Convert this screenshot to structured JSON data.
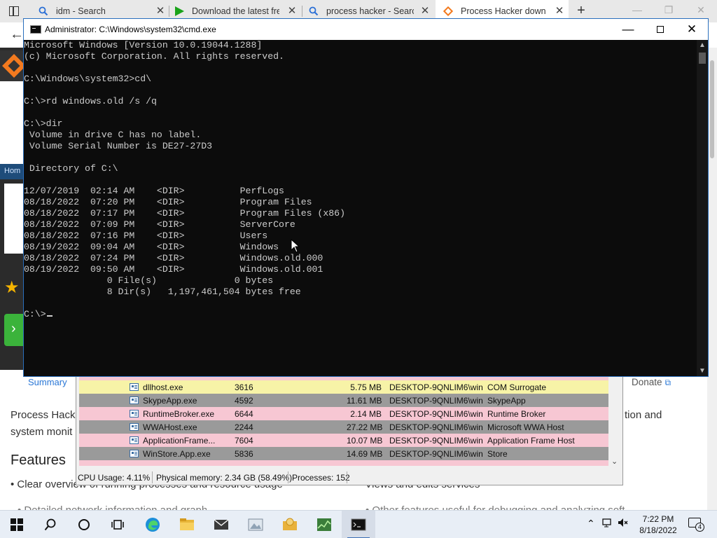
{
  "browser": {
    "tabs": [
      {
        "title": "idm - Search",
        "icon": "search-icon"
      },
      {
        "title": "Download the latest fre",
        "icon": "play-icon"
      },
      {
        "title": "process hacker - Search",
        "icon": "search-icon"
      },
      {
        "title": "Process Hacker downlo",
        "icon": "process-hacker-logo"
      }
    ],
    "side_label": "Hom",
    "summary_link": "Summary",
    "donate_link": "Donate",
    "para1_left": "Process Hack",
    "para1_right": "tion and",
    "para2": "system monit",
    "features_heading": "Features",
    "bullet_left": "• Clear overview of running processes and resource usage",
    "bullet_right": "• Views and edits services",
    "cut_left": "• Detailed network information and graphs",
    "cut_right": "• Other features useful for debugging and analyzing software"
  },
  "process_hacker": {
    "rows": [
      {
        "name": "dllhost.exe",
        "pid": "3616",
        "mem": "5.75 MB",
        "user": "DESKTOP-9QNLIM6\\win",
        "desc": "COM Surrogate",
        "bg": "#f7f3a7"
      },
      {
        "name": "SkypeApp.exe",
        "pid": "4592",
        "mem": "11.61 MB",
        "user": "DESKTOP-9QNLIM6\\win",
        "desc": "SkypeApp",
        "bg": "#9a9a9a"
      },
      {
        "name": "RuntimeBroker.exe",
        "pid": "6644",
        "mem": "2.14 MB",
        "user": "DESKTOP-9QNLIM6\\win",
        "desc": "Runtime Broker",
        "bg": "#f7c7d3"
      },
      {
        "name": "WWAHost.exe",
        "pid": "2244",
        "mem": "27.22 MB",
        "user": "DESKTOP-9QNLIM6\\win",
        "desc": "Microsoft WWA Host",
        "bg": "#9a9a9a"
      },
      {
        "name": "ApplicationFrame...",
        "pid": "7604",
        "mem": "10.07 MB",
        "user": "DESKTOP-9QNLIM6\\win",
        "desc": "Application Frame Host",
        "bg": "#f7c7d3"
      },
      {
        "name": "WinStore.App.exe",
        "pid": "5836",
        "mem": "14.69 MB",
        "user": "DESKTOP-9QNLIM6\\win",
        "desc": "Store",
        "bg": "#9a9a9a"
      }
    ],
    "status": {
      "cpu": "CPU Usage: 4.11%",
      "memory": "Physical memory: 2.34 GB (58.49%)",
      "processes": "Processes: 152"
    }
  },
  "cmd": {
    "title": "Administrator: C:\\Windows\\system32\\cmd.exe",
    "lines": [
      "Microsoft Windows [Version 10.0.19044.1288]",
      "(c) Microsoft Corporation. All rights reserved.",
      "",
      "C:\\Windows\\system32>cd\\",
      "",
      "C:\\>rd windows.old /s /q",
      "",
      "C:\\>dir",
      " Volume in drive C has no label.",
      " Volume Serial Number is DE27-27D3",
      "",
      " Directory of C:\\",
      "",
      "12/07/2019  02:14 AM    <DIR>          PerfLogs",
      "08/18/2022  07:20 PM    <DIR>          Program Files",
      "08/18/2022  07:17 PM    <DIR>          Program Files (x86)",
      "08/18/2022  07:09 PM    <DIR>          ServerCore",
      "08/18/2022  07:16 PM    <DIR>          Users",
      "08/19/2022  09:04 AM    <DIR>          Windows",
      "08/18/2022  07:24 PM    <DIR>          Windows.old.000",
      "08/19/2022  09:50 AM    <DIR>          Windows.old.001",
      "               0 File(s)              0 bytes",
      "               8 Dir(s)   1,197,461,504 bytes free",
      ""
    ],
    "prompt": "C:\\>"
  },
  "taskbar": {
    "apps": [
      "start-icon",
      "search-icon",
      "cortana-icon",
      "task-view-icon",
      "edge-icon",
      "file-explorer-icon",
      "mail-icon",
      "image-viewer-icon",
      "folder-app-icon",
      "process-hacker-icon",
      "cmd-icon"
    ],
    "time": "7:22 PM",
    "date": "8/18/2022",
    "notification_count": "4"
  }
}
